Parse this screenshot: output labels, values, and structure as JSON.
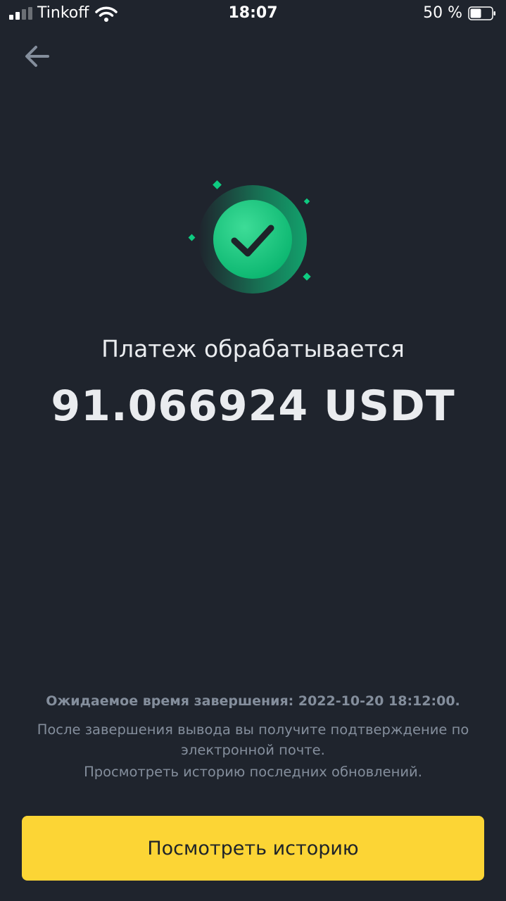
{
  "status_bar": {
    "carrier": "Tinkoff",
    "time": "18:07",
    "battery_percent_text": "50 %",
    "battery_level": 0.5,
    "signal_bars_active": 2,
    "signal_bars_total": 4
  },
  "nav": {
    "back_icon": "arrow-left-icon"
  },
  "status": {
    "icon": "check-circle-icon",
    "title": "Платеж обрабатывается",
    "amount": "91.066924 USDT"
  },
  "info": {
    "eta": "Ожидаемое время завершения: 2022-10-20 18:12:00.",
    "note": "После завершения вывода вы получите подтверждение по электронной почте.",
    "history_link": "Просмотреть историю последних обновлений."
  },
  "actions": {
    "primary_label": "Посмотреть историю"
  },
  "colors": {
    "background": "#1f242d",
    "accent": "#fcd535",
    "success": "#0ecb81",
    "text_primary": "#eaecef",
    "text_secondary": "#848e9c"
  }
}
